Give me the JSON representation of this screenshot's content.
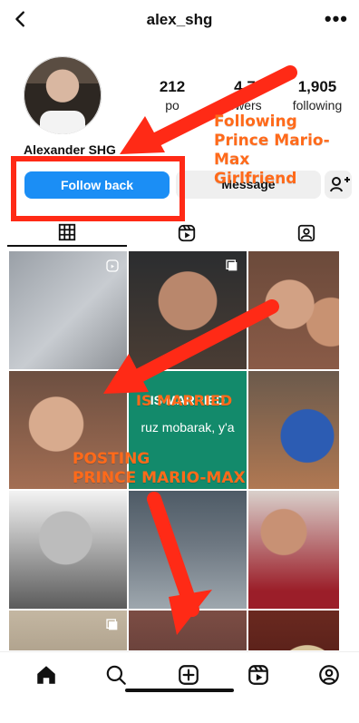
{
  "header": {
    "username": "alex_shg"
  },
  "profile": {
    "display_name": "Alexander SHG",
    "stats": [
      {
        "value": "212",
        "label": "po"
      },
      {
        "value": "4,7",
        "label": "owers"
      },
      {
        "value": "1,905",
        "label": "following"
      }
    ]
  },
  "actions": {
    "follow_back": "Follow back",
    "message": "Message"
  },
  "annotations": {
    "following_lines": [
      "Following",
      "Prince Mario-Max",
      "Girlfriend"
    ],
    "married": "IS MARRIED",
    "posting_lines": [
      "POSTING",
      "PRINCE MARIO-MAX"
    ]
  },
  "grid": {
    "green_caption": "IS MARRIED",
    "green_line2": "ruz mobarak, y'a"
  },
  "colors": {
    "accent_blue": "#1b8ef5",
    "annotation_red": "#ff2a16",
    "annotation_orange": "#ff6a1a"
  },
  "icons": {
    "top_left": "back-icon",
    "top_right": "more-icon",
    "tabs": [
      "grid-icon",
      "reels-icon",
      "tagged-icon"
    ],
    "nav": [
      "home-icon",
      "search-icon",
      "create-icon",
      "reels-icon",
      "profile-icon"
    ]
  }
}
